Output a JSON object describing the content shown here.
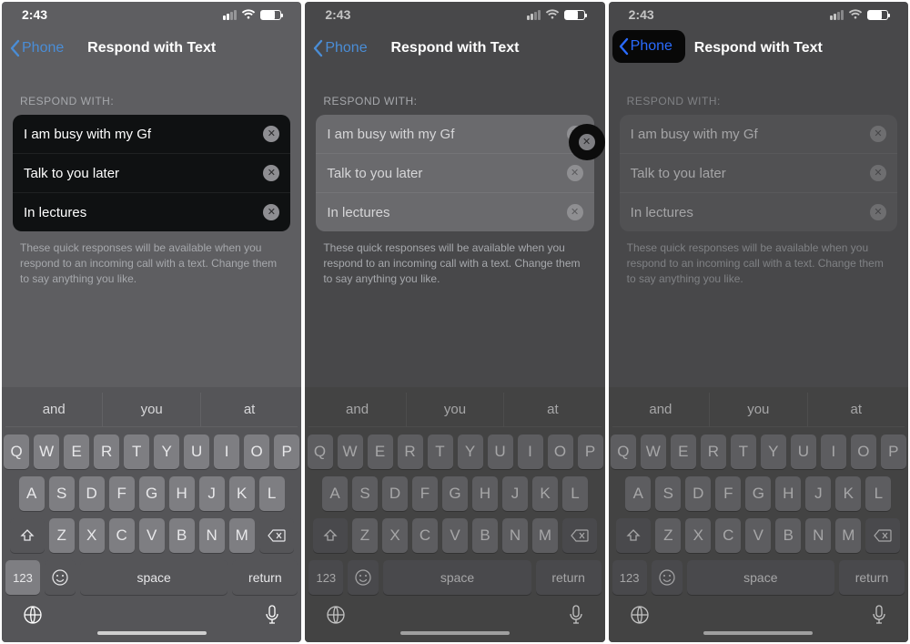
{
  "status": {
    "time": "2:43"
  },
  "nav": {
    "back_label": "Phone",
    "title": "Respond with Text"
  },
  "section": {
    "header": "RESPOND WITH:",
    "rows": [
      {
        "text": "I am busy with my Gf"
      },
      {
        "text": "Talk to you later"
      },
      {
        "text": "In lectures"
      }
    ],
    "footer": "These quick responses will be available when you respond to an incoming call with a text. Change them to say anything you like."
  },
  "keyboard": {
    "suggestions": [
      "and",
      "you",
      "at"
    ],
    "row1": [
      "Q",
      "W",
      "E",
      "R",
      "T",
      "Y",
      "U",
      "I",
      "O",
      "P"
    ],
    "row2": [
      "A",
      "S",
      "D",
      "F",
      "G",
      "H",
      "J",
      "K",
      "L"
    ],
    "row3": [
      "Z",
      "X",
      "C",
      "V",
      "B",
      "N",
      "M"
    ],
    "numbers_key": "123",
    "space_key": "space",
    "return_key": "return"
  },
  "clear_glyph": "✕"
}
